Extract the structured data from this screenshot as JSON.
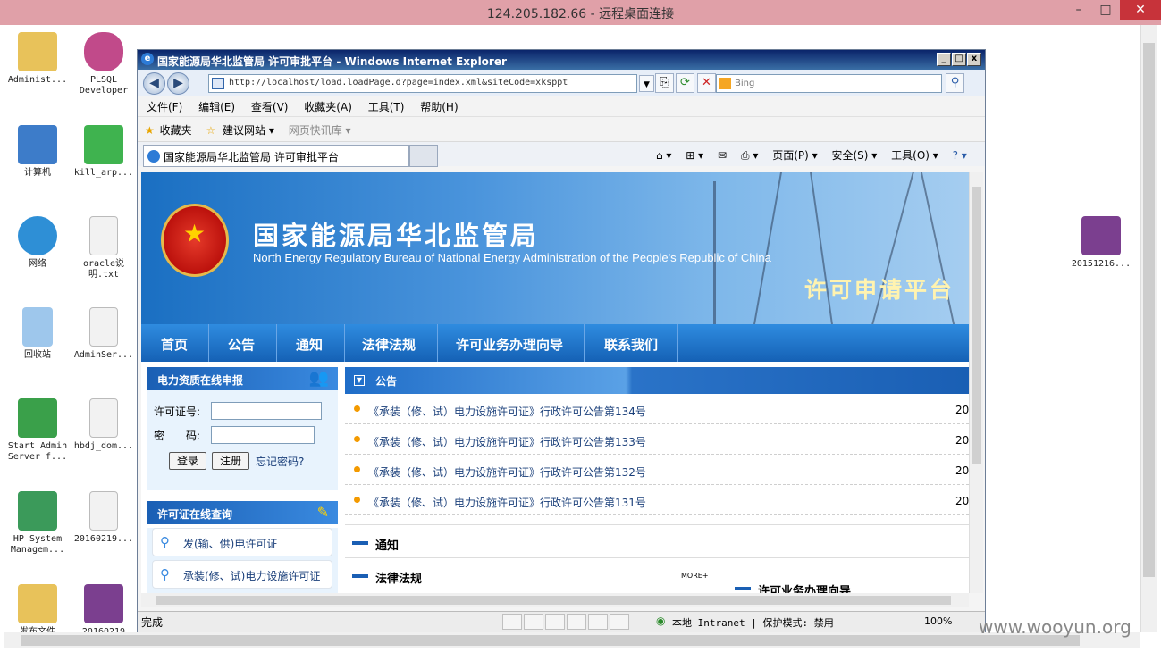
{
  "rdp": {
    "title": "124.205.182.66 - 远程桌面连接",
    "min": "–",
    "max": "□",
    "close": "✕"
  },
  "desktop_icons": [
    {
      "label": "Administ...",
      "color": "#e8c25a"
    },
    {
      "label": "PLSQL Developer",
      "color": "#c14a8a"
    },
    {
      "label": "计算机",
      "color": "#3d7cc9"
    },
    {
      "label": "kill_arp...",
      "color": "#3fb34f"
    },
    {
      "label": "网络",
      "color": "#2e8fd6"
    },
    {
      "label": "oracle说明.txt",
      "color": "#f2f2f2"
    },
    {
      "label": "回收站",
      "color": "#9ec7ec"
    },
    {
      "label": "AdminSer...",
      "color": "#f2f2f2"
    },
    {
      "label": "Start Admin Server f...",
      "color": "#3aa04a"
    },
    {
      "label": "hbdj_dom...",
      "color": "#f2f2f2"
    },
    {
      "label": "HP System Managem...",
      "color": "#3b9a5a"
    },
    {
      "label": "20160219...",
      "color": "#f2f2f2"
    },
    {
      "label": "发布文件",
      "color": "#e8c25a"
    },
    {
      "label": "20160219",
      "color": "#7b3f8f"
    },
    {
      "label": "20151216...",
      "color": "#7b3f8f"
    }
  ],
  "ie": {
    "title": "国家能源局华北监管局 许可审批平台 - Windows Internet Explorer",
    "address": "http://localhost/load.loadPage.d?page=index.xml&siteCode=xksppt",
    "search_placeholder": "Bing",
    "menu": [
      "文件(F)",
      "编辑(E)",
      "查看(V)",
      "收藏夹(A)",
      "工具(T)",
      "帮助(H)"
    ],
    "favorites": [
      "收藏夹",
      "建议网站 ▾",
      "网页快讯库 ▾"
    ],
    "tab_label": "国家能源局华北监管局 许可审批平台",
    "commands": [
      "页面(P) ▾",
      "安全(S) ▾",
      "工具(O) ▾"
    ],
    "status_text": "完成",
    "zone": "本地 Intranet | 保护模式: 禁用",
    "zoom": "100%"
  },
  "site": {
    "title_cn": "国家能源局华北监管局",
    "title_en": "North Energy Regulatory Bureau of National Energy Administration of the People's Republic of China",
    "platform": "许可申请平台",
    "nav": [
      "首页",
      "公告",
      "通知",
      "法律法规",
      "许可业务办理向导",
      "联系我们"
    ],
    "login_header": "电力资质在线申报",
    "license_label": "许可证号:",
    "password_label": "密　　码:",
    "login_btn": "登录",
    "register_btn": "注册",
    "forgot": "忘记密码?",
    "query_header": "许可证在线查询",
    "query_items": [
      "发(输、供)电许可证",
      "承装(修、试)电力设施许可证"
    ],
    "announce_header": "公告",
    "announcements": [
      {
        "text": "《承装（修、试）电力设施许可证》行政许可公告第134号",
        "date": "20"
      },
      {
        "text": "《承装（修、试）电力设施许可证》行政许可公告第133号",
        "date": "20"
      },
      {
        "text": "《承装（修、试）电力设施许可证》行政许可公告第132号",
        "date": "20"
      },
      {
        "text": "《承装（修、试）电力设施许可证》行政许可公告第131号",
        "date": "20"
      }
    ],
    "notice_header": "通知",
    "law_header": "法律法规",
    "more": "MORE+",
    "guide_header": "许可业务办理向导"
  },
  "watermark": "www.wooyun.org"
}
